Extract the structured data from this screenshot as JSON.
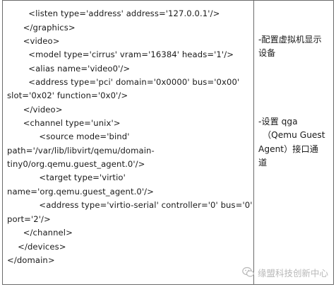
{
  "code_lines": [
    "        <listen type='address' address='127.0.0.1'/>",
    "      </graphics>",
    "      <video>",
    "        <model type='cirrus' vram='16384' heads='1'/>",
    "        <alias name='video0'/>",
    "        <address type='pci' domain='0x0000' bus='0x00'",
    "slot='0x02' function='0x0'/>",
    "      </video>",
    "      <channel type='unix'>",
    "            <source mode='bind'",
    "path='/var/lib/libvirt/qemu/domain-",
    "tiny0/org.qemu.guest_agent.0'/>",
    "            <target type='virtio'",
    "name='org.qemu.guest_agent.0'/>",
    "            <address type='virtio-serial' controller='0' bus='0'",
    "port='2'/>",
    "      </channel>",
    "    </devices>",
    "</domain>"
  ],
  "notes": {
    "video_line1": "-配置虚拟机显示",
    "video_line2": "设备",
    "qga_line1": "-设置 qga",
    "qga_line2": "（Qemu Guest",
    "qga_line3": "Agent）接口通",
    "qga_line4": "道"
  },
  "watermark": {
    "text": "缘盟科技创新中心",
    "icon": "wechat-icon"
  },
  "colors": {
    "border": "#6b6b6b",
    "text": "#1a1a1a",
    "watermark": "#b8b8b8"
  }
}
